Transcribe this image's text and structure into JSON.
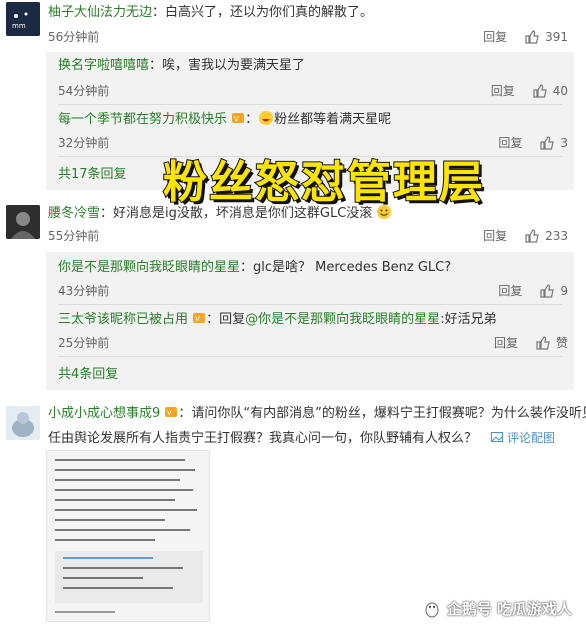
{
  "comments": [
    {
      "user": "柚子大仙法力无边",
      "text": "：白高兴了，还以为你们真的解散了。",
      "time": "56分钟前",
      "reply": "回复",
      "likes": "391"
    },
    {
      "user": "腰冬冷雪",
      "text": "：好消息是ig没散，坏消息是你们这群GLC没滚",
      "time": "55分钟前",
      "reply": "回复",
      "likes": "233"
    },
    {
      "user": "小成小成心想事成9",
      "text_a": "：请问你队“有内部消息”的粉丝，爆料宁王打假赛呢？为什么装作没听见？",
      "text_b": "任由舆论发展所有人指责宁王打假赛？我真心问一句，你队野辅有人权么？",
      "review_image": "评论配图"
    }
  ],
  "sub_replies_1": [
    {
      "user": "换名字啦嘻嘻嘻",
      "text": "：唉，害我以为要满天星了",
      "time": "54分钟前",
      "reply": "回复",
      "likes": "40"
    },
    {
      "user": "每一个季节都在努力积极快乐",
      "text": "粉丝都等着满天星呢",
      "time": "32分钟前",
      "reply": "回复",
      "likes": "3"
    }
  ],
  "more_1": "共17条回复",
  "sub_replies_2": [
    {
      "user": "你是不是那颗向我眨眼睛的星星",
      "text": "：glc是啥？ Mercedes Benz GLC?",
      "time": "43分钟前",
      "reply": "回复",
      "likes": "9"
    },
    {
      "user": "三太爷该昵称已被占用",
      "text_a": "：回复",
      "mention": "@你是不是那颗向我眨眼睛的星星",
      "text_b": ":好活兄弟",
      "time": "25分钟前",
      "reply": "回复",
      "likes": "赞"
    }
  ],
  "more_2": "共4条回复",
  "overlay_title": "粉丝怒怼管理层",
  "watermark": "企鹅号 吃瓜游戏人",
  "colors": {
    "link": "#2a7f2a",
    "overlay": "#ffe400",
    "subbox": "#f2f2f2"
  }
}
